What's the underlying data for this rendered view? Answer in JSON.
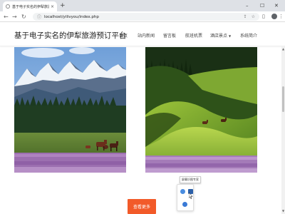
{
  "browser": {
    "tab_title": "基于电子实名的伊犁旅游预订平",
    "tab_close": "×",
    "new_tab": "+",
    "url": "localhost/yilivyou/index.php",
    "win_min": "–",
    "win_max": "☐",
    "win_close": "✕"
  },
  "site": {
    "brand": "基于电子实名的伊犁旅游预订平台",
    "menu": [
      {
        "label": "首页"
      },
      {
        "label": "站内新闻"
      },
      {
        "label": "留言板"
      },
      {
        "label": "航班机票"
      },
      {
        "label": "酒店景点",
        "caret": "▼"
      },
      {
        "label": "系统简介"
      }
    ],
    "more_button": "查看更多",
    "tooltip": "屏幕识图专家"
  },
  "colors": {
    "accent": "#f25a29",
    "chrome": "#dee1e6"
  }
}
